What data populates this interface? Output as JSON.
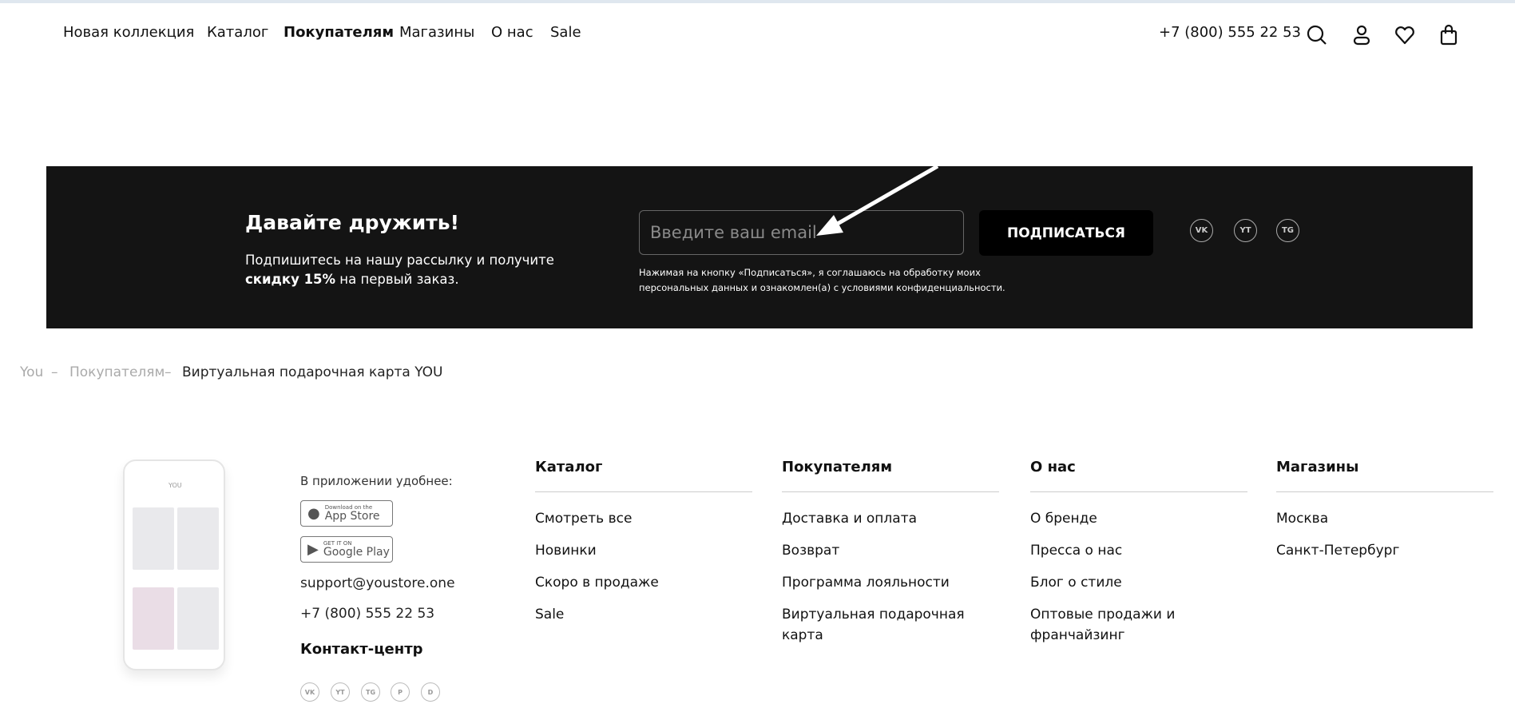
{
  "header": {
    "nav": [
      "Новая коллекция",
      "Каталог",
      "Покупателям",
      "Магазины",
      "О нас",
      "Sale"
    ],
    "active": "Покупателям",
    "phone": "+7 (800) 555 22 53",
    "icons": [
      "search-icon",
      "user-icon",
      "heart-icon",
      "bag-icon"
    ]
  },
  "subscribe": {
    "title": "Давайте дружить!",
    "text_line1": "Подпишитесь на нашу рассылку и получите",
    "text_bold": "скидку 15%",
    "text_rest": " на первый заказ.",
    "email_placeholder": "Введите ваш email",
    "email_value": "",
    "button": "ПОДПИСАТЬСЯ",
    "consent_line1": "Нажимая на кнопку «Подписаться», я соглашаюсь на обработку моих",
    "consent_line2": "персональных данных и ознакомлен(а) с условиями конфиденциальности.",
    "social": [
      "VK",
      "YT",
      "TG"
    ]
  },
  "breadcrumb": [
    "You",
    "Покупателям",
    "Виртуальная подарочная карта YOU"
  ],
  "footer": {
    "app_text": "В приложении удобнее:",
    "appstore": {
      "small": "Download on the",
      "big": "App Store"
    },
    "googleplay": {
      "small": "GET IT ON",
      "big": "Google Play"
    },
    "email": "support@youstore.one",
    "phone": "+7 (800) 555 22 53",
    "contact_center": "Контакт-центр",
    "social": [
      "VK",
      "YT",
      "TG",
      "P",
      "D"
    ],
    "columns": [
      {
        "title": "Каталог",
        "items": [
          "Смотреть все",
          "Новинки",
          "Скоро в продаже",
          "Sale"
        ]
      },
      {
        "title": "Покупателям",
        "items": [
          "Доставка и оплата",
          "Возврат",
          "Программа лояльности",
          "Виртуальная подарочная карта"
        ]
      },
      {
        "title": "О нас",
        "items": [
          "О бренде",
          "Пресса о нас",
          "Блог о стиле",
          "Оптовые продажи и франчайзинг"
        ]
      },
      {
        "title": "Магазины",
        "items": [
          "Москва",
          "Санкт-Петербург"
        ]
      }
    ]
  }
}
